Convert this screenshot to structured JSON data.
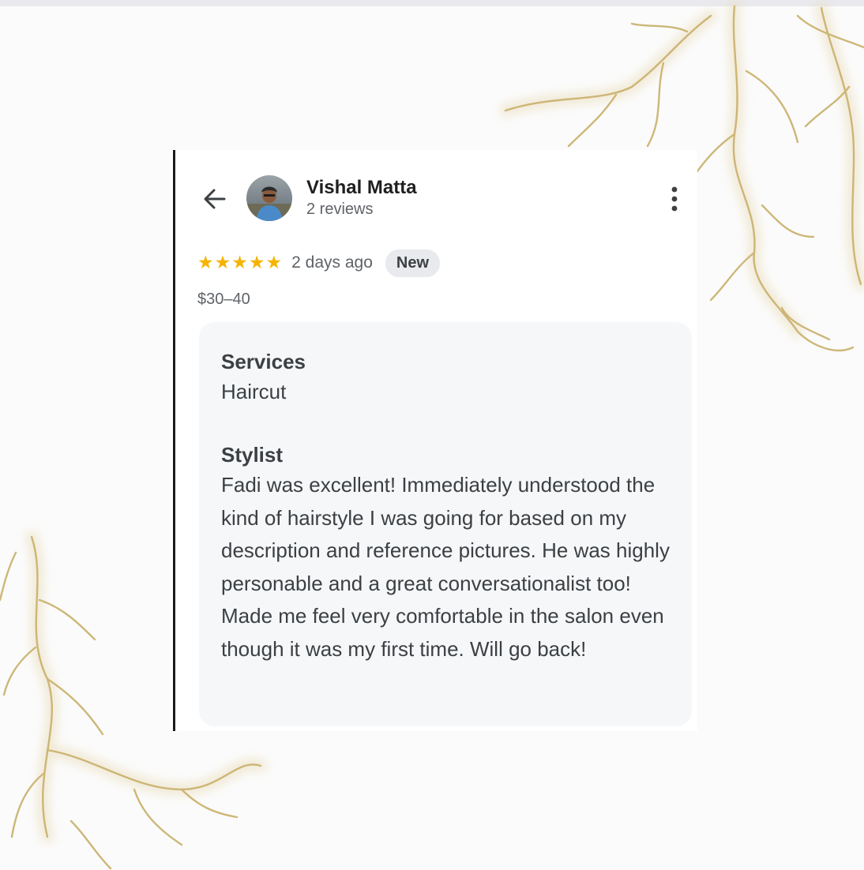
{
  "header": {
    "back_icon": "arrow-left-icon",
    "more_icon": "more-vertical-icon"
  },
  "reviewer": {
    "name": "Vishal Matta",
    "reviews_count": "2 reviews"
  },
  "review": {
    "rating": 5,
    "rating_max": 5,
    "date": "2 days ago",
    "badge": "New",
    "price": "$30–40",
    "services_label": "Services",
    "services_value": "Haircut",
    "stylist_label": "Stylist",
    "text": "Fadi was excellent! Immediately understood the kind of hairstyle I was going for based on my description and reference pictures. He was highly personable and a great conversationalist too! Made me feel very comfortable in the salon even though it was my first time. Will go back!"
  },
  "colors": {
    "star": "#f4b400",
    "badge_bg": "#e8eaed",
    "details_bg": "#f6f7f9",
    "gold_decor": "#c9b06a"
  }
}
